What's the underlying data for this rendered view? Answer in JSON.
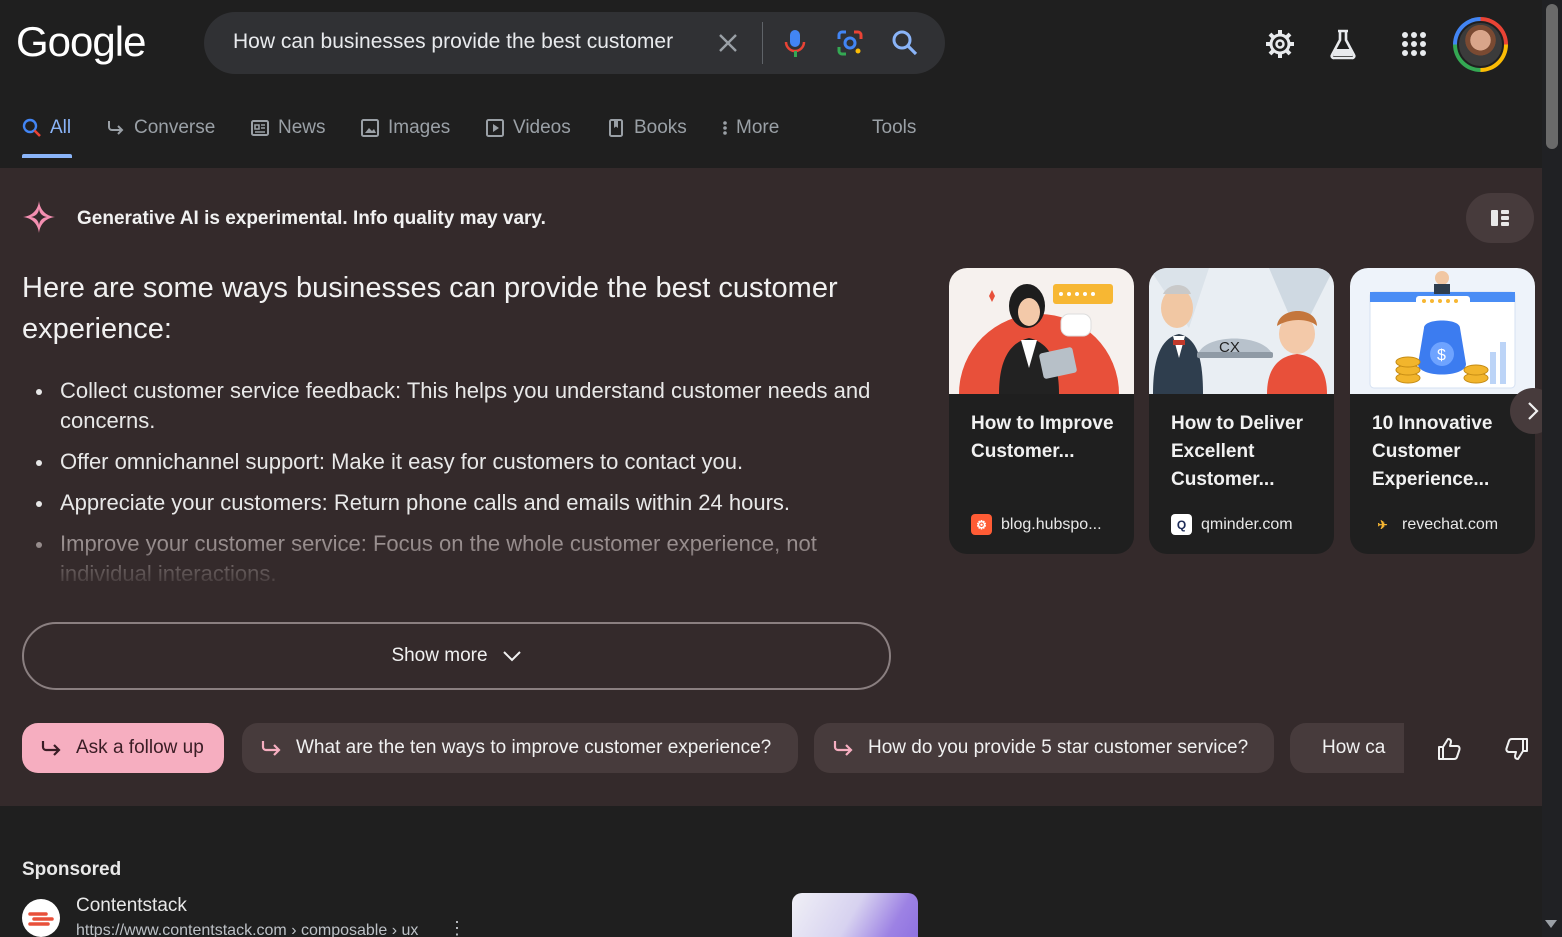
{
  "header": {
    "logo": "Google",
    "search_query": "How can businesses provide the best customer",
    "icons": [
      "close-icon",
      "mic-icon",
      "lens-icon",
      "search-icon",
      "gear-icon",
      "labs-icon",
      "apps-icon",
      "avatar"
    ]
  },
  "tabs": [
    {
      "label": "All",
      "icon": "search-icon",
      "active": true
    },
    {
      "label": "Converse",
      "icon": "follow-up-icon"
    },
    {
      "label": "News",
      "icon": "news-icon"
    },
    {
      "label": "Images",
      "icon": "image-icon"
    },
    {
      "label": "Videos",
      "icon": "video-icon"
    },
    {
      "label": "Books",
      "icon": "book-icon"
    },
    {
      "label": "More",
      "icon": "more-vert-icon"
    },
    {
      "label": "Tools"
    }
  ],
  "ai": {
    "badge": "Generative AI is experimental. Info quality may vary.",
    "heading": "Here are some ways businesses can provide the best customer experience:",
    "points": [
      "Collect customer service feedback: This helps you understand customer needs and concerns.",
      "Offer omnichannel support: Make it easy for customers to contact you.",
      "Appreciate your customers: Return phone calls and emails within 24 hours.",
      "Improve your customer service: Focus on the whole customer experience, not individual interactions."
    ],
    "show_more": "Show more",
    "cards": [
      {
        "title": "How to Improve Customer...",
        "source": "blog.hubspo..."
      },
      {
        "title": "How to Deliver Excellent Customer...",
        "source": "qminder.com"
      },
      {
        "title": "10 Innovative Customer Experience...",
        "source": "revechat.com"
      }
    ],
    "ask_follow_up": "Ask a follow up",
    "suggestions": [
      "What are the ten ways to improve customer experience?",
      "How do you provide 5 star customer service?",
      "How ca"
    ]
  },
  "sponsored": {
    "label": "Sponsored",
    "advertiser": "Contentstack",
    "url": "https://www.contentstack.com › composable › ux"
  },
  "colors": {
    "accent": "#8ab4f8",
    "ai_background": "#342a2b",
    "chip_primary": "#f6aec0"
  }
}
